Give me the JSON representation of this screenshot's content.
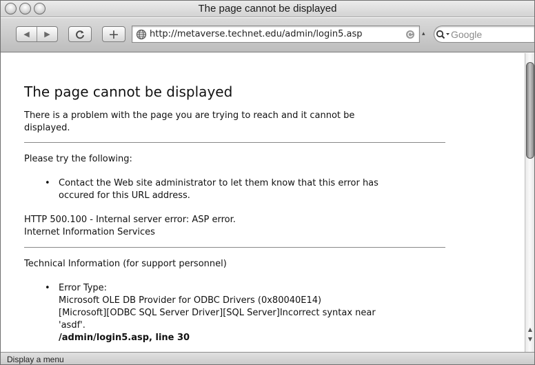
{
  "window": {
    "title": "The page cannot be displayed"
  },
  "toolbar": {
    "back_glyph": "◀",
    "forward_glyph": "▶",
    "reload_glyph": "C",
    "add_bookmark_glyph": "+",
    "url": "http://metaverse.technet.edu/admin/login5.asp",
    "search_placeholder": "Google"
  },
  "page": {
    "heading": "The page cannot be displayed",
    "intro_line1": "There is a problem with the page you are trying to reach and it cannot be",
    "intro_line2": "displayed.",
    "try_label": "Please try the following:",
    "try_items": [
      {
        "line1": "Contact the Web site administrator to let them know that this error has",
        "line2": "occured for this URL address."
      }
    ],
    "error_code": "HTTP 500.100 - Internal server error: ASP error.",
    "server": "Internet Information Services",
    "tech_label": "Technical Information (for support personnel)",
    "tech_items": [
      {
        "label": "Error Type:",
        "provider": "Microsoft OLE DB Provider for ODBC Drivers (0x80040E14)",
        "message_line1": "[Microsoft][ODBC SQL Server Driver][SQL Server]Incorrect syntax near",
        "message_line2": "'asdf'.",
        "location": "/admin/login5.asp, line 30"
      }
    ]
  },
  "status": {
    "text": "Display a menu"
  },
  "icons": {
    "site": "globe-icon",
    "search": "magnifier-icon",
    "url_reload": "circular-arrow-icon"
  },
  "colors": {
    "traffic_light": "#d9d9d9",
    "rule": "#888888"
  }
}
